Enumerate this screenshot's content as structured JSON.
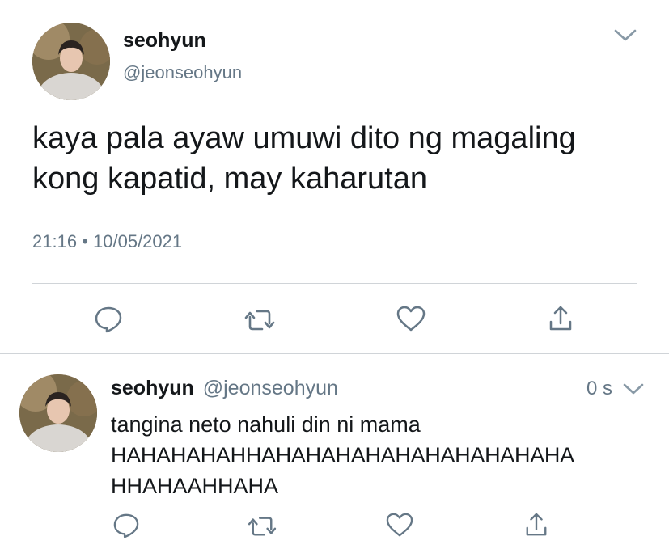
{
  "main_tweet": {
    "display_name": "seohyun",
    "handle": "@jeonseohyun",
    "text_line1": "kaya pala ayaw umuwi dito ng magaling",
    "text_line2": "kong kapatid, may kaharutan",
    "time": "21:16",
    "separator": "•",
    "date": "10/05/2021"
  },
  "reply_tweet": {
    "display_name": "seohyun",
    "handle": "@jeonseohyun",
    "age": "0 s",
    "text_line1": "tangina neto nahuli din ni mama",
    "text_line2": "HAHAHAHAHHAHAHAHAHAHAHAHAHAHAHA",
    "text_line3": "HHAHAAHHAHA"
  },
  "icons": {
    "chevron": "chevron-down-icon",
    "reply": "reply-icon",
    "retweet": "retweet-icon",
    "like": "heart-icon",
    "share": "share-icon"
  },
  "colors": {
    "text": "#14171a",
    "secondary": "#657786",
    "icon": "#657786",
    "divider": "#d0d4d8"
  }
}
